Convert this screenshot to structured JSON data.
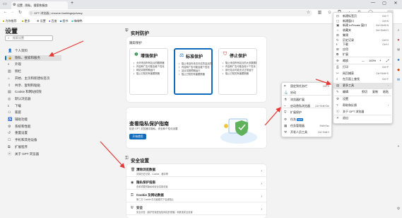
{
  "browser": {
    "tab_title": "设置 - 隐私、搜索和服务",
    "url": "GPT 浏览器  |  chrome://settings/privacy",
    "favorites": [
      "为你推荐",
      "更多",
      "设置",
      "百度",
      "图书",
      "嗨嗨鸭"
    ]
  },
  "sidebar": {
    "title": "设置",
    "search_placeholder": "搜索设置",
    "items": [
      {
        "label": "个人资料",
        "icon": "👤",
        "active": false
      },
      {
        "label": "隐私、搜索和服务",
        "icon": "🔒",
        "active": true
      },
      {
        "label": "外观",
        "icon": "◐",
        "active": false
      },
      {
        "label": "侧栏",
        "icon": "▥",
        "active": false
      },
      {
        "label": "开始、主页和新建标签页",
        "icon": "⌂",
        "active": false
      },
      {
        "label": "共享、复制和粘贴",
        "icon": "⇪",
        "active": false
      },
      {
        "label": "Cookie 和网站权限",
        "icon": "▤",
        "active": false
      },
      {
        "label": "默认浏览器",
        "icon": "◎",
        "active": false
      },
      {
        "label": "下载",
        "icon": "⭳",
        "active": false
      },
      {
        "label": "家庭",
        "icon": "⚇",
        "active": false
      },
      {
        "label": "辅助功能",
        "icon": "♿",
        "active": false
      },
      {
        "label": "系统和性能",
        "icon": "⚙",
        "active": false
      },
      {
        "label": "重置设置",
        "icon": "↺",
        "active": false
      },
      {
        "label": "手机和其他设备",
        "icon": "☐",
        "active": false
      },
      {
        "label": "扩展程序",
        "icon": "⧉",
        "active": false
      },
      {
        "label": "关于 GPT 浏览器",
        "icon": "ⓔ",
        "active": false
      }
    ]
  },
  "tracking": {
    "section_title": "实时防护",
    "card_heading": "跟踪保护",
    "options": [
      {
        "icon": "✽",
        "title": "增强保护",
        "color": "#1a7f37",
        "bullets": [
          "允许来自所有站点的跟踪器",
          "内容和广告可能会被个性化",
          "网站将按预期运行",
          "阻止已知的有害跟踪器"
        ],
        "selected": false
      },
      {
        "icon": "⚖",
        "title": "标准保护",
        "color": "#0f6cbd",
        "bullets": [
          "阻止来自你未访问过的站点的跟踪器",
          "内容和广告可能会被个性化",
          "站点将按预期运行",
          "阻止已知的有害跟踪器"
        ],
        "selected": true
      },
      {
        "icon": "⛉",
        "title": "停止保护",
        "color": "#c42b1c",
        "bullets": [
          "阻止来自所有站点的大多数跟踪器",
          "内容和广告可能会较少个性化",
          "部分站点可能无法正常运行",
          "阻止已知的有害跟踪器"
        ],
        "selected": false
      }
    ]
  },
  "privacy_promo": {
    "title": "查看隐私保护指南",
    "desc": "检查 GPT 浏览器中隐私、安全和个性化设置",
    "button": "开始使用"
  },
  "security": {
    "section_title": "安全设置",
    "rows": [
      {
        "icon": "🗑",
        "title": "清除浏览数据",
        "sub": "清除历史记录、Cookie、缓存等"
      },
      {
        "icon": "◉",
        "title": "隐私保护指南",
        "sub": "查看重要的隐私和安全控制设置"
      },
      {
        "icon": "⚿",
        "title": "Cookie 及网站数据",
        "sub": "第三方 Cookie 在无痕模式下会被阻止"
      },
      {
        "icon": "⛨",
        "title": "安全",
        "sub": "安全浏览（保护您免受危险网站的侵害）和其他安全设置"
      }
    ]
  },
  "menu": {
    "items": [
      {
        "icon": "⊡",
        "label": "新建标签页",
        "shortcut": "Ctrl+T"
      },
      {
        "icon": "▢",
        "label": "新建窗口",
        "shortcut": "Ctrl+N"
      },
      {
        "icon": "▣",
        "label": "新建 InPrivate 窗口",
        "shortcut": "Ctrl+Shift+N"
      },
      {
        "icon": "☆",
        "label": "收藏夹",
        "shortcut": "Ctrl+Shift+O"
      },
      {
        "icon": "⊞",
        "label": "集锦",
        "shortcut": ""
      },
      {
        "icon": "↻",
        "label": "历史记录",
        "shortcut": "Ctrl+H"
      },
      {
        "icon": "⭳",
        "label": "下载",
        "shortcut": "Ctrl+J"
      },
      {
        "icon": "⊞",
        "label": "应用",
        "shortcut": ""
      },
      {
        "icon": "⧉",
        "label": "扩展",
        "shortcut": ""
      }
    ],
    "zoom": {
      "label": "缩放",
      "minus": "—",
      "value": "100%",
      "plus": "+",
      "full": "⤢"
    },
    "items2": [
      {
        "icon": "⎙",
        "label": "打印",
        "shortcut": "Ctrl+P"
      },
      {
        "icon": "✂",
        "label": "网页捕获",
        "shortcut": "Ctrl+Shift+S"
      },
      {
        "icon": "⌕",
        "label": "在页面上查找",
        "shortcut": "Ctrl+F"
      },
      {
        "icon": "▤",
        "label": "更多工具",
        "shortcut": "›",
        "highlight": true
      }
    ],
    "edit": {
      "label": "编辑",
      "cut": "剪切",
      "copy": "复制",
      "paste": "粘贴"
    },
    "items3": [
      {
        "icon": "⚙",
        "label": "设置",
        "shortcut": ""
      },
      {
        "icon": "?",
        "label": "帮助和反馈",
        "shortcut": "›"
      },
      {
        "icon": "ⓔ",
        "label": "关于 GPT 浏览器",
        "shortcut": ""
      },
      {
        "icon": "✕",
        "label": "退出",
        "shortcut": ""
      }
    ]
  },
  "submenu": {
    "items": [
      {
        "icon": "⌗",
        "label": "固定到任务栏",
        "shortcut": "Ctrl+S"
      },
      {
        "icon": "⚓",
        "label": "启动",
        "shortcut": ""
      },
      {
        "icon": "⚗",
        "label": "浏览器扩展",
        "shortcut": ""
      },
      {
        "icon": "⌁",
        "label": "启动隐私浏览器",
        "shortcut": "Ctrl+Shift+Del"
      },
      {
        "icon": "⛨",
        "label": "扩展保护",
        "shortcut": ""
      },
      {
        "icon": "⚙",
        "label": "任务",
        "badge": "NEW",
        "shortcut": ""
      },
      {
        "icon": "▦",
        "label": "任务管理器",
        "shortcut": "Shift+Esc"
      },
      {
        "icon": "⚒",
        "label": "开发人员工具",
        "shortcut": "Ctrl+Shift+I"
      }
    ]
  }
}
